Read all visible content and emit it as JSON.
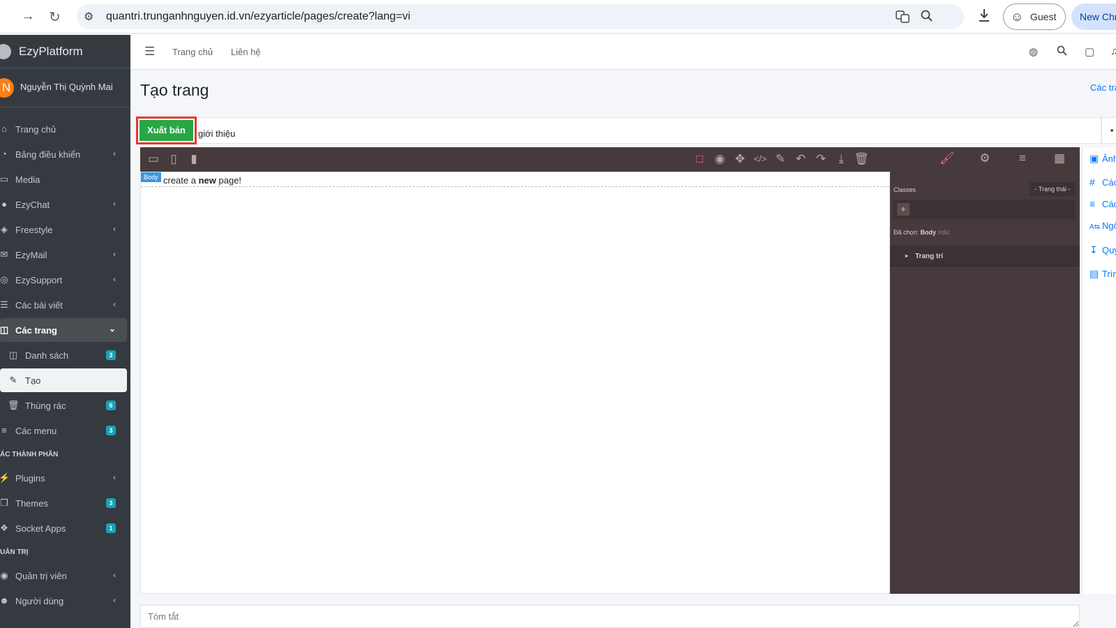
{
  "browser": {
    "url": "quantri.trunganhnguyen.id.vn/ezyarticle/pages/create?lang=vi",
    "guest_label": "Guest",
    "new_chrome_label": "New Chr"
  },
  "sidebar": {
    "brand": "EzyPlatform",
    "user_initial": "N",
    "user_name": "Nguyễn Thị Quỳnh Mai",
    "items": [
      {
        "label": "Trang chủ",
        "icon": "home-icon"
      },
      {
        "label": "Bảng điều khiển",
        "icon": "dashboard-icon"
      },
      {
        "label": "Media",
        "icon": "image-icon"
      },
      {
        "label": "EzyChat",
        "icon": "chat-icon"
      },
      {
        "label": "Freestyle",
        "icon": "cube-icon"
      },
      {
        "label": "EzyMail",
        "icon": "mail-icon"
      },
      {
        "label": "EzySupport",
        "icon": "lifebuoy-icon"
      },
      {
        "label": "Các bài viết",
        "icon": "list-icon"
      },
      {
        "label": "Các trang",
        "icon": "columns-icon"
      },
      {
        "label": "Danh sách",
        "icon": "columns-icon",
        "badge": "3"
      },
      {
        "label": "Tạo",
        "icon": "edit-icon"
      },
      {
        "label": "Thùng rác",
        "icon": "trash-icon",
        "badge": "6"
      },
      {
        "label": "Các menu",
        "icon": "bars-icon",
        "badge": "3"
      },
      {
        "label": "Plugins",
        "icon": "plug-icon"
      },
      {
        "label": "Themes",
        "icon": "clone-icon",
        "badge": "3"
      },
      {
        "label": "Socket Apps",
        "icon": "cubes-icon",
        "badge": "1"
      },
      {
        "label": "Quản trị viên",
        "icon": "user-circle-icon"
      },
      {
        "label": "Người dùng",
        "icon": "users-icon"
      }
    ],
    "headers": [
      "ÁC THÀNH PHẦN",
      "UẢN TRỊ"
    ]
  },
  "topnav": {
    "home_link": "Trang chủ",
    "contact_link": "Liên hệ"
  },
  "page": {
    "title": "Tạo trang",
    "breadcrumb": "Các tra",
    "publish_label": "Xuất bản",
    "title_value": "giới thiệu",
    "summary_placeholder": "Tóm tắt"
  },
  "editor": {
    "body_tag": "Body",
    "body_text_pre": "create a ",
    "body_text_bold": "new",
    "body_text_post": " page!",
    "classes_label": "Classes",
    "state_label": "- Trạng thái -",
    "selected_label": "Đã chọn:",
    "selected_value": "Body",
    "selected_id": "#dkl",
    "section_label": "Trang trí"
  },
  "right_sidebar": {
    "items": [
      "Ảnh",
      "Các",
      "Các",
      "Ngô",
      "Quy",
      "Trìn"
    ]
  },
  "colors": {
    "sidebar_bg": "#343a40",
    "editor_bg": "#463a3c",
    "publish_green": "#28a745",
    "highlight_red": "#e53935",
    "active_tool": "#e06fa3"
  }
}
